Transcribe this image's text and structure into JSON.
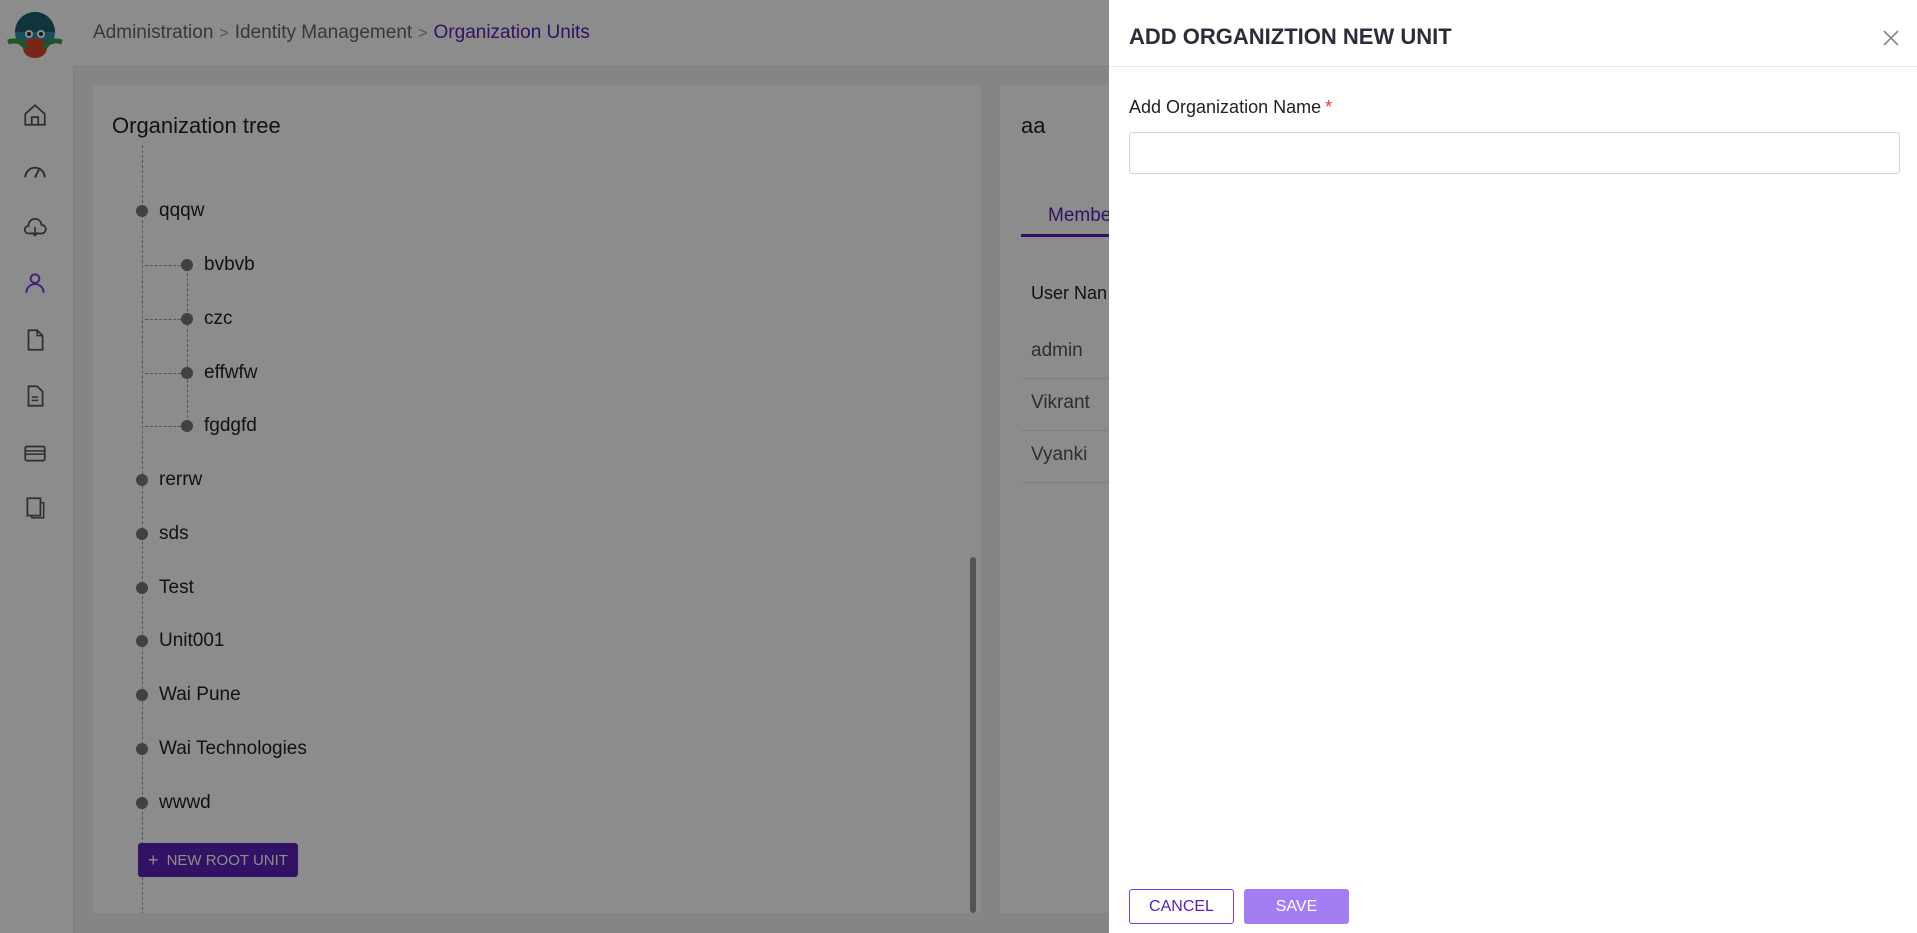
{
  "breadcrumb": {
    "items": [
      "Administration",
      "Identity Management"
    ],
    "current": "Organization Units",
    "separator": ">"
  },
  "sidebar": {
    "icons": [
      "home-icon",
      "dashboard-gauge-icon",
      "cloud-icon",
      "user-icon",
      "file-icon",
      "document-icon",
      "card-icon",
      "pages-icon"
    ],
    "active_index": 3
  },
  "tree": {
    "title": "Organization tree",
    "nodes": [
      {
        "label": "qqqw",
        "level": 0
      },
      {
        "label": "bvbvb",
        "level": 1
      },
      {
        "label": "czc",
        "level": 1
      },
      {
        "label": "effwfw",
        "level": 1
      },
      {
        "label": "fgdgfd",
        "level": 1
      },
      {
        "label": "rerrw",
        "level": 0
      },
      {
        "label": "sds",
        "level": 0
      },
      {
        "label": "Test",
        "level": 0
      },
      {
        "label": "Unit001",
        "level": 0
      },
      {
        "label": "Wai Pune",
        "level": 0
      },
      {
        "label": "Wai Technologies",
        "level": 0
      },
      {
        "label": "wwwd",
        "level": 0
      }
    ],
    "new_root_label": "NEW ROOT UNIT"
  },
  "unit_panel": {
    "title": "aa",
    "tab_label": "Membe",
    "column_header": "User Nan",
    "members": [
      "admin",
      "Vikrant",
      "Vyanki"
    ]
  },
  "drawer": {
    "title": "ADD ORGANIZTION NEW UNIT",
    "field_label": "Add Organization Name",
    "required_mark": "*",
    "field_value": "",
    "cancel_label": "CANCEL",
    "save_label": "SAVE"
  },
  "colors": {
    "accent": "#5b21b6",
    "save_button": "#a37ef2",
    "required": "#e53935"
  }
}
